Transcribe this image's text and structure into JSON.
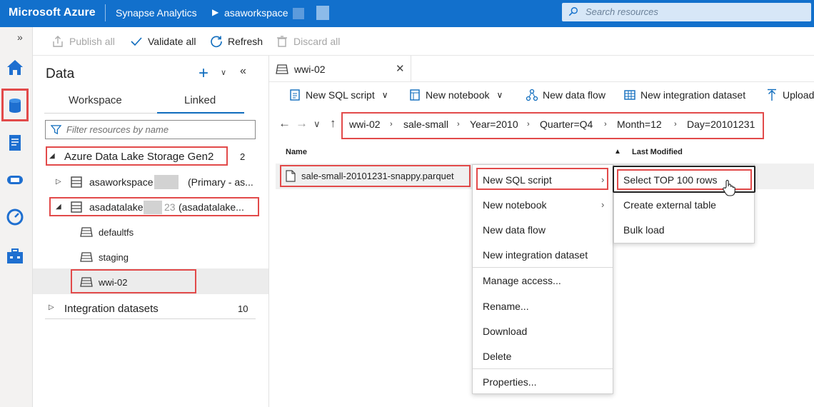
{
  "topbar": {
    "brand": "Microsoft Azure",
    "service": "Synapse Analytics",
    "workspace": "asaworkspace",
    "search_placeholder": "Search resources"
  },
  "toolbar": {
    "publish_all": "Publish all",
    "validate_all": "Validate all",
    "refresh": "Refresh",
    "discard_all": "Discard all"
  },
  "data_panel": {
    "title": "Data",
    "tabs": [
      "Workspace",
      "Linked"
    ],
    "active_tab": "Linked",
    "filter_placeholder": "Filter resources by name",
    "adls_group": {
      "label": "Azure Data Lake Storage Gen2",
      "count": "2"
    },
    "accounts": [
      {
        "name": "asaworkspace",
        "suffix": "(Primary - as..."
      },
      {
        "name": "asadatalake",
        "suffix": "(asadatalake..."
      }
    ],
    "asadatalake_partial": "23",
    "containers": [
      "defaultfs",
      "staging",
      "wwi-02"
    ],
    "integration_group": {
      "label": "Integration datasets",
      "count": "10"
    }
  },
  "main": {
    "tab_label": "wwi-02",
    "actions": {
      "new_sql_script": "New SQL script",
      "new_notebook": "New notebook",
      "new_data_flow": "New data flow",
      "new_integration_dataset": "New integration dataset",
      "upload": "Upload"
    },
    "path": [
      "wwi-02",
      "sale-small",
      "Year=2010",
      "Quarter=Q4",
      "Month=12",
      "Day=20101231"
    ],
    "columns": {
      "name": "Name",
      "last_modified": "Last Modified"
    },
    "file": "sale-small-20101231-snappy.parquet"
  },
  "context_menu": {
    "items": [
      "New SQL script",
      "New notebook",
      "New data flow",
      "New integration dataset",
      "Manage access...",
      "Rename...",
      "Download",
      "Delete",
      "Properties..."
    ]
  },
  "submenu": {
    "items": [
      "Select TOP 100 rows",
      "Create external table",
      "Bulk load"
    ]
  }
}
